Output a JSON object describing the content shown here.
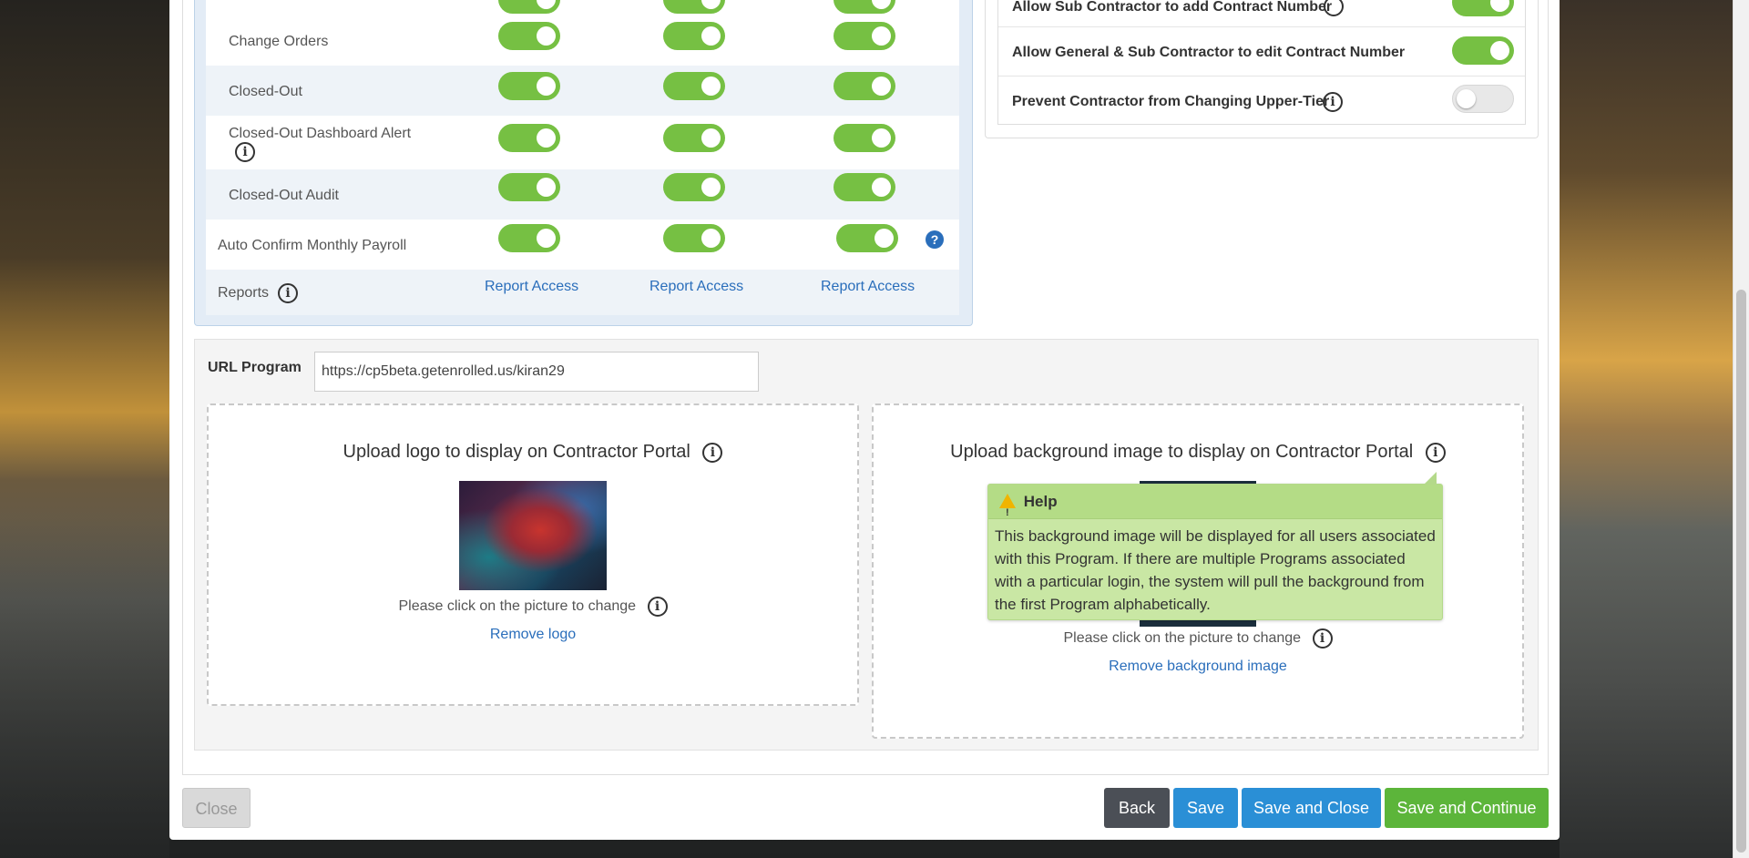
{
  "permissions": {
    "rows": [
      {
        "label": "Change Orders"
      },
      {
        "label": "Closed-Out"
      },
      {
        "label": "Closed-Out Dashboard Alert"
      },
      {
        "label": "Closed-Out Audit"
      },
      {
        "label": "Auto Confirm Monthly Payroll"
      },
      {
        "label": "Reports"
      }
    ],
    "report_link": "Report Access"
  },
  "settings": {
    "rows": [
      {
        "label": "Allow Sub Contractor to add Contract Number"
      },
      {
        "label": "Allow General & Sub Contractor to edit Contract Number"
      },
      {
        "label": "Prevent Contractor from Changing Upper-Tier"
      }
    ]
  },
  "url_program": {
    "label": "URL Program",
    "value": "https://cp5beta.getenrolled.us/kiran29"
  },
  "logo_upload": {
    "title": "Upload logo to display on Contractor Portal",
    "note": "Please click on the picture to change",
    "remove": "Remove logo"
  },
  "background_upload": {
    "title": "Upload background image to display on Contractor Portal",
    "note": "Please click on the picture to change",
    "remove": "Remove background image"
  },
  "tooltip": {
    "title": "Help",
    "body": "This background image will be displayed for all users associated with this Program. If there are multiple Programs associated with a particular login, the system will pull the background from the first Program alphabetically."
  },
  "buttons": {
    "close": "Close",
    "back": "Back",
    "save": "Save",
    "save_close": "Save and Close",
    "save_continue": "Save and Continue"
  },
  "colors": {
    "toggle_on": "#76c043",
    "link": "#2a6ebb",
    "primary": "#2a8fd6",
    "success": "#5cb53a",
    "tooltip_bg": "#c9e7a4"
  }
}
